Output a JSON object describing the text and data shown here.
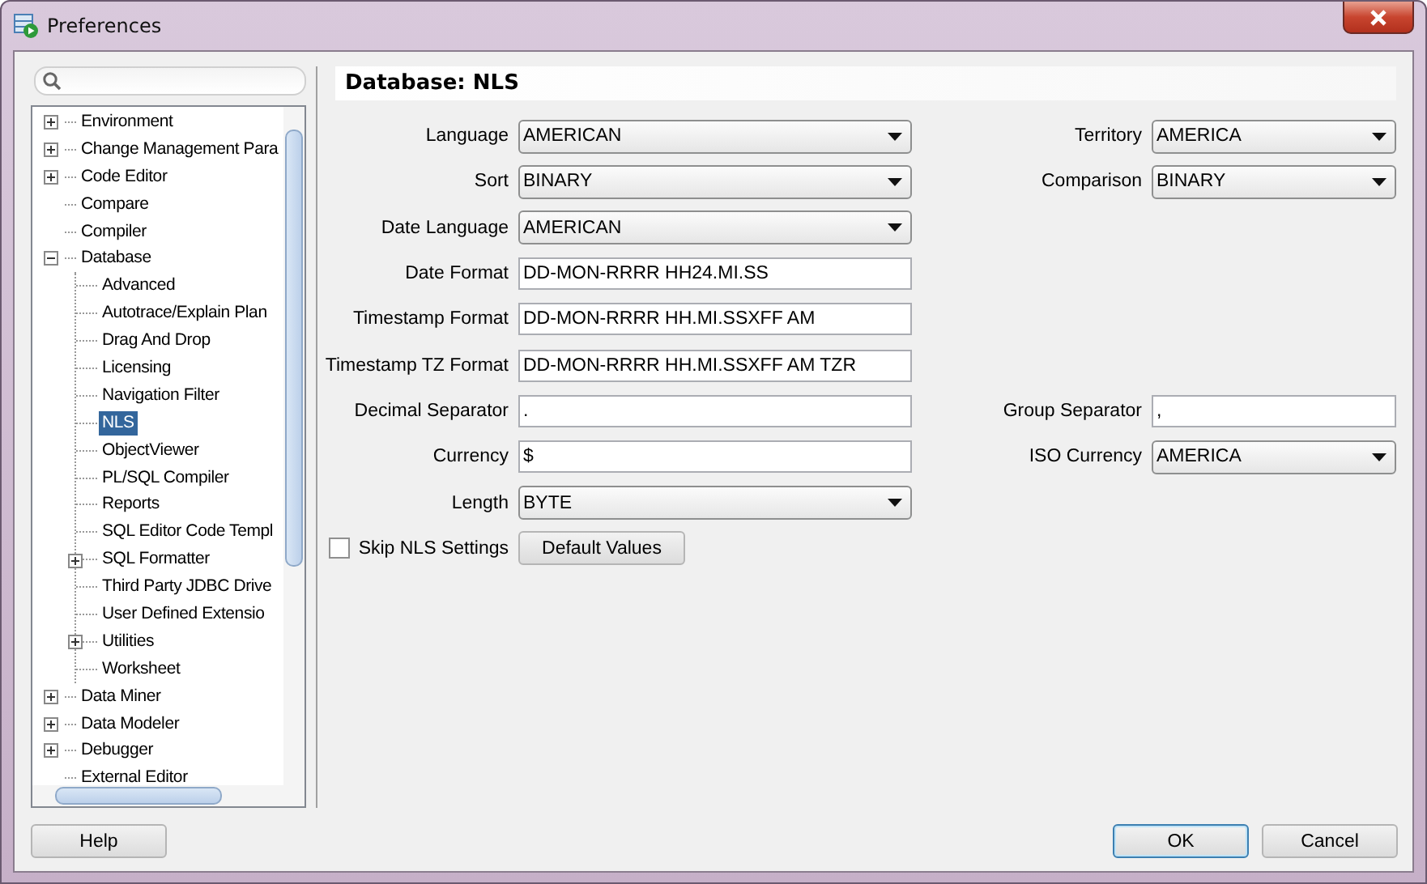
{
  "window": {
    "title": "Preferences"
  },
  "tree": [
    {
      "label": "Environment",
      "kind": "group",
      "expanded": false,
      "selected": false
    },
    {
      "label": "Change Management Para",
      "kind": "group",
      "expanded": false,
      "selected": false
    },
    {
      "label": "Code Editor",
      "kind": "group",
      "expanded": false,
      "selected": false
    },
    {
      "label": "Compare",
      "kind": "leaf",
      "selected": false
    },
    {
      "label": "Compiler",
      "kind": "leaf",
      "selected": false
    },
    {
      "label": "Database",
      "kind": "group",
      "expanded": true,
      "selected": false,
      "children": [
        {
          "label": "Advanced",
          "kind": "leaf",
          "selected": false
        },
        {
          "label": "Autotrace/Explain Plan",
          "kind": "leaf",
          "selected": false
        },
        {
          "label": "Drag And Drop",
          "kind": "leaf",
          "selected": false
        },
        {
          "label": "Licensing",
          "kind": "leaf",
          "selected": false
        },
        {
          "label": "Navigation Filter",
          "kind": "leaf",
          "selected": false
        },
        {
          "label": "NLS",
          "kind": "leaf",
          "selected": true
        },
        {
          "label": "ObjectViewer",
          "kind": "leaf",
          "selected": false
        },
        {
          "label": "PL/SQL Compiler",
          "kind": "leaf",
          "selected": false
        },
        {
          "label": "Reports",
          "kind": "leaf",
          "selected": false
        },
        {
          "label": "SQL Editor Code Templ",
          "kind": "leaf",
          "selected": false
        },
        {
          "label": "SQL Formatter",
          "kind": "group",
          "expanded": false,
          "selected": false
        },
        {
          "label": "Third Party JDBC Drive",
          "kind": "leaf",
          "selected": false
        },
        {
          "label": "User Defined Extensio",
          "kind": "leaf",
          "selected": false
        },
        {
          "label": "Utilities",
          "kind": "group",
          "expanded": false,
          "selected": false
        },
        {
          "label": "Worksheet",
          "kind": "leaf",
          "selected": false
        }
      ]
    },
    {
      "label": "Data Miner",
      "kind": "group",
      "expanded": false,
      "selected": false
    },
    {
      "label": "Data Modeler",
      "kind": "group",
      "expanded": false,
      "selected": false
    },
    {
      "label": "Debugger",
      "kind": "group",
      "expanded": false,
      "selected": false
    },
    {
      "label": "External Editor",
      "kind": "leaf",
      "selected": false
    }
  ],
  "panel": {
    "title": "Database: NLS"
  },
  "rows": [
    {
      "left": {
        "label": "Language",
        "kind": "select",
        "value": "AMERICAN"
      },
      "right": {
        "label": "Territory",
        "kind": "select",
        "value": "AMERICA"
      }
    },
    {
      "left": {
        "label": "Sort",
        "kind": "select",
        "value": "BINARY"
      },
      "right": {
        "label": "Comparison",
        "kind": "select",
        "value": "BINARY"
      }
    },
    {
      "left": {
        "label": "Date Language",
        "kind": "select",
        "value": "AMERICAN"
      }
    },
    {
      "left": {
        "label": "Date Format",
        "kind": "text",
        "value": "DD-MON-RRRR HH24.MI.SS"
      }
    },
    {
      "left": {
        "label": "Timestamp Format",
        "kind": "text",
        "value": "DD-MON-RRRR HH.MI.SSXFF AM"
      }
    },
    {
      "left": {
        "label": "Timestamp TZ Format",
        "kind": "text",
        "value": "DD-MON-RRRR HH.MI.SSXFF AM TZR"
      }
    },
    {
      "left": {
        "label": "Decimal Separator",
        "kind": "text",
        "value": "."
      },
      "right": {
        "label": "Group Separator",
        "kind": "text",
        "value": ","
      }
    },
    {
      "left": {
        "label": "Currency",
        "kind": "text",
        "value": "$"
      },
      "right": {
        "label": "ISO Currency",
        "kind": "select",
        "value": "AMERICA"
      }
    },
    {
      "left": {
        "label": "Length",
        "kind": "select",
        "value": "BYTE"
      }
    }
  ],
  "skip_nls": {
    "label": "Skip NLS Settings",
    "checked": false
  },
  "default_button": {
    "label": "Default Values"
  },
  "buttons": [
    {
      "label": "Help",
      "focused": false
    },
    {
      "label": "OK",
      "focused": true
    },
    {
      "label": "Cancel",
      "focused": false
    }
  ]
}
